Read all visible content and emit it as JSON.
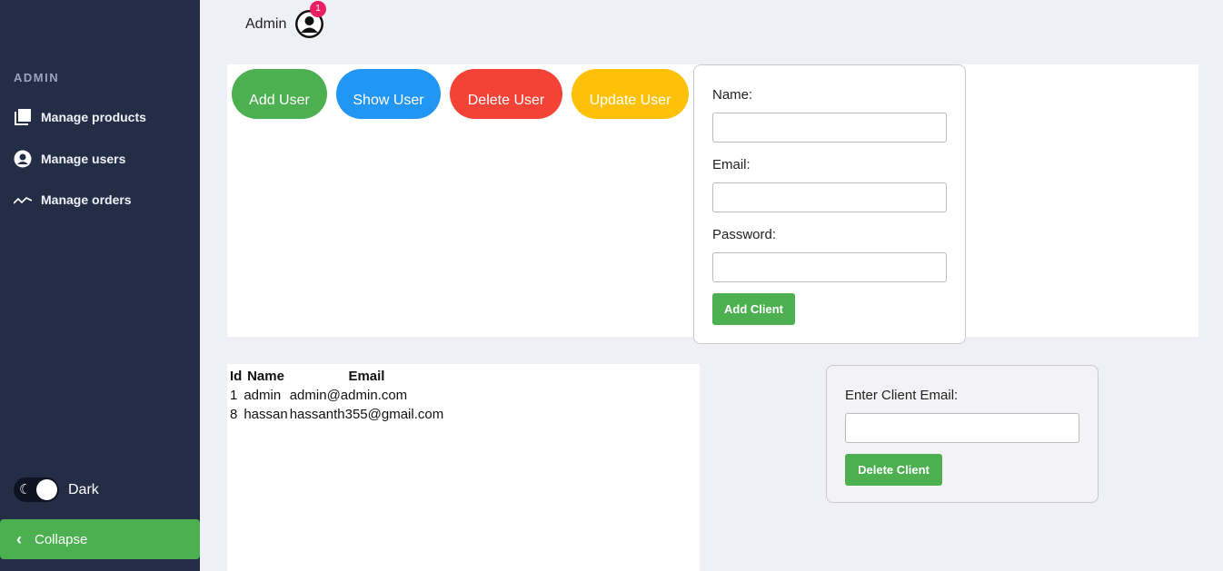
{
  "sidebar": {
    "heading": "ADMIN",
    "items": [
      {
        "label": "Manage products",
        "icon": "products-icon"
      },
      {
        "label": "Manage users",
        "icon": "user-circle-icon"
      },
      {
        "label": "Manage orders",
        "icon": "chart-line-icon"
      }
    ],
    "dark_label": "Dark",
    "collapse_label": "Collapse"
  },
  "header": {
    "admin_name": "Admin",
    "notification_count": "1"
  },
  "actions": {
    "add_user": "Add User",
    "show_user": "Show User",
    "delete_user": "Delete User",
    "update_user": "Update User"
  },
  "add_form": {
    "name_label": "Name:",
    "email_label": "Email:",
    "password_label": "Password:",
    "name_value": "",
    "email_value": "",
    "password_value": "",
    "submit_label": "Add Client"
  },
  "users_table": {
    "headers": [
      "Id",
      "Name",
      "Email"
    ],
    "rows": [
      [
        "1",
        "admin",
        "admin@admin.com"
      ],
      [
        "8",
        "hassan",
        "hassanth355@gmail.com"
      ]
    ]
  },
  "delete_form": {
    "email_label": "Enter Client Email:",
    "email_value": "",
    "submit_label": "Delete Client"
  },
  "colors": {
    "sidebar_bg": "#232d45",
    "green": "#4caf50",
    "blue": "#2196f3",
    "red": "#f44336",
    "yellow": "#ffc107",
    "badge": "#e91e63"
  }
}
